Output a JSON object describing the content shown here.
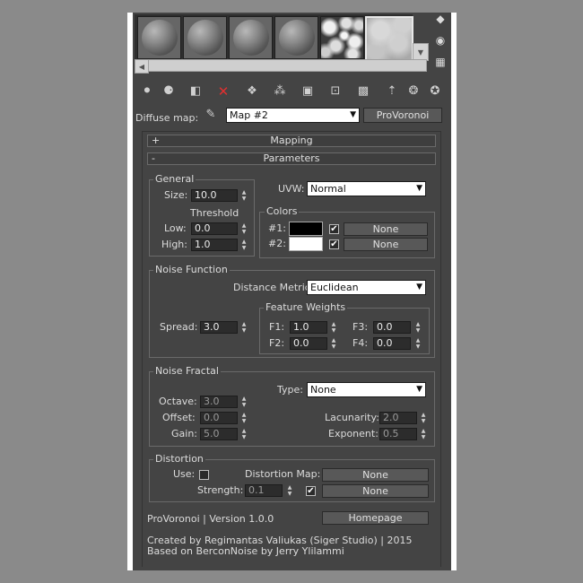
{
  "slots": [
    "sphere",
    "sphere",
    "sphere",
    "sphere",
    "noise",
    "noise-selected"
  ],
  "side_icons": [
    "sample-type-icon",
    "backlight-icon",
    "background-icon"
  ],
  "toolbar": [
    "get-material-icon",
    "put-material-icon",
    "assign-material-icon",
    "reset-icon",
    "copy-material-icon",
    "make-unique-icon",
    "put-to-library-icon",
    "material-id-icon",
    "show-map-icon",
    "show-end-result-icon",
    "go-to-parent-icon",
    "go-forward-icon",
    "select-by-material-icon"
  ],
  "map_row": {
    "label": "Diffuse map:",
    "map_name": "Map #2",
    "map_type": "ProVoronoi"
  },
  "rollouts": {
    "mapping": {
      "sign": "+",
      "title": "Mapping"
    },
    "parameters": {
      "sign": "-",
      "title": "Parameters"
    }
  },
  "general": {
    "title": "General",
    "size_label": "Size:",
    "size_value": "10.0",
    "threshold_label": "Threshold",
    "low_label": "Low:",
    "low_value": "0.0",
    "high_label": "High:",
    "high_value": "1.0"
  },
  "uvw": {
    "label": "UVW:",
    "value": "Normal"
  },
  "colors": {
    "title": "Colors",
    "c1_label": "#1:",
    "c1_color": "#000000",
    "c1_checked": true,
    "c1_map": "None",
    "c2_label": "#2:",
    "c2_color": "#ffffff",
    "c2_checked": true,
    "c2_map": "None"
  },
  "noise_function": {
    "title": "Noise Function",
    "metric_label": "Distance Metric:",
    "metric_value": "Euclidean",
    "spread_label": "Spread:",
    "spread_value": "3.0",
    "weights_title": "Feature Weights",
    "f1_label": "F1:",
    "f1_value": "1.0",
    "f2_label": "F2:",
    "f2_value": "0.0",
    "f3_label": "F3:",
    "f3_value": "0.0",
    "f4_label": "F4:",
    "f4_value": "0.0"
  },
  "noise_fractal": {
    "title": "Noise Fractal",
    "type_label": "Type:",
    "type_value": "None",
    "octave_label": "Octave:",
    "octave_value": "3.0",
    "offset_label": "Offset:",
    "offset_value": "0.0",
    "gain_label": "Gain:",
    "gain_value": "5.0",
    "lacunarity_label": "Lacunarity:",
    "lacunarity_value": "2.0",
    "exponent_label": "Exponent:",
    "exponent_value": "0.5"
  },
  "distortion": {
    "title": "Distortion",
    "use_label": "Use:",
    "use_checked": false,
    "map_label": "Distortion Map:",
    "map_value": "None",
    "strength_label": "Strength:",
    "strength_value": "0.1",
    "strength_checked": true,
    "strength_map": "None"
  },
  "footer": {
    "version": "ProVoronoi | Version 1.0.0",
    "homepage": "Homepage",
    "credit1": "Created by Regimantas Valiukas (Siger Studio) | 2015",
    "credit2": "Based on BerconNoise by Jerry Ylilammi"
  },
  "colors_ui": {
    "panel": "#444444",
    "frame": "#ffffff",
    "background": "#8a8a8a"
  }
}
